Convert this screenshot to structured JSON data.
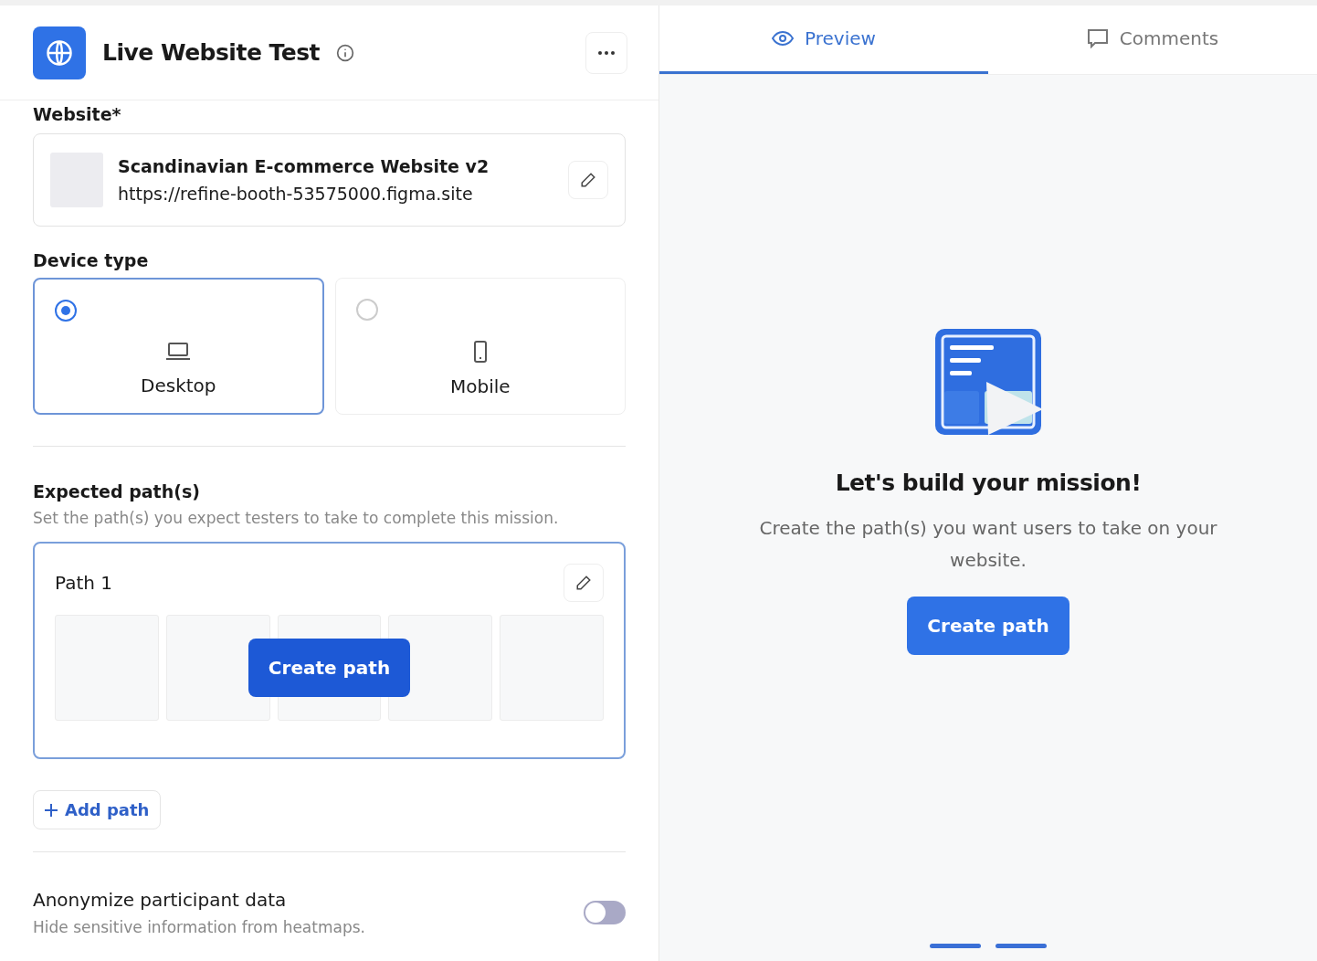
{
  "header": {
    "title": "Live Website Test"
  },
  "website": {
    "label": "Website*",
    "name": "Scandinavian E-commerce Website v2",
    "url": "https://refine-booth-53575000.figma.site"
  },
  "device_type": {
    "label": "Device type",
    "options": [
      {
        "kind": "desktop",
        "label": "Desktop",
        "selected": true
      },
      {
        "kind": "mobile",
        "label": "Mobile",
        "selected": false
      }
    ]
  },
  "expected_paths": {
    "title": "Expected path(s)",
    "description": "Set the path(s) you expect testers to take to complete this mission.",
    "paths": [
      {
        "name": "Path 1",
        "button": "Create path"
      }
    ],
    "add_button": "Add path"
  },
  "anonymize": {
    "title": "Anonymize participant data",
    "description": "Hide sensitive information from heatmaps.",
    "on": false
  },
  "tabs": [
    {
      "kind": "preview",
      "label": "Preview",
      "selected": true
    },
    {
      "kind": "comments",
      "label": "Comments",
      "selected": false
    }
  ],
  "empty_state": {
    "title": "Let's build your mission!",
    "description": "Create the path(s) you want users to take on your website.",
    "button": "Create path"
  }
}
